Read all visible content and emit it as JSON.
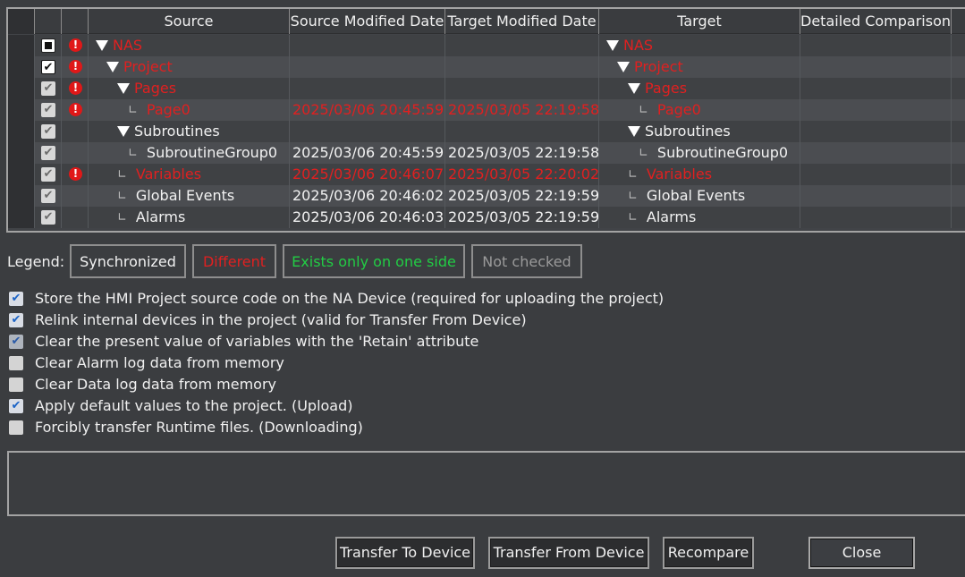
{
  "columns": {
    "source": "Source",
    "source_modified": "Source Modified Date",
    "target_modified": "Target Modified Date",
    "target": "Target",
    "detailed": "Detailed Comparison"
  },
  "rows": [
    {
      "check": "partial",
      "warn": true,
      "level": 0,
      "expander": true,
      "source": "NAS",
      "src_date": "",
      "tgt_date": "",
      "target": "NAS",
      "status": "different"
    },
    {
      "check": "checked",
      "warn": true,
      "level": 1,
      "expander": true,
      "source": "Project",
      "src_date": "",
      "tgt_date": "",
      "target": "Project",
      "status": "different"
    },
    {
      "check": "checked",
      "warn": true,
      "level": 2,
      "expander": true,
      "source": "Pages",
      "src_date": "",
      "tgt_date": "",
      "target": "Pages",
      "status": "different"
    },
    {
      "check": "checked",
      "warn": true,
      "level": 3,
      "expander": false,
      "source": "Page0",
      "src_date": "2025/03/06 20:45:59",
      "tgt_date": "2025/03/05 22:19:58",
      "target": "Page0",
      "status": "different"
    },
    {
      "check": "checked",
      "warn": false,
      "level": 2,
      "expander": true,
      "source": "Subroutines",
      "src_date": "",
      "tgt_date": "",
      "target": "Subroutines",
      "status": "synchronized"
    },
    {
      "check": "checked",
      "warn": false,
      "level": 3,
      "expander": false,
      "source": "SubroutineGroup0",
      "src_date": "2025/03/06 20:45:59",
      "tgt_date": "2025/03/05 22:19:58",
      "target": "SubroutineGroup0",
      "status": "synchronized"
    },
    {
      "check": "checked",
      "warn": true,
      "level": 2,
      "expander": false,
      "source": "Variables",
      "src_date": "2025/03/06 20:46:07",
      "tgt_date": "2025/03/05 22:20:02",
      "target": "Variables",
      "status": "different"
    },
    {
      "check": "checked",
      "warn": false,
      "level": 2,
      "expander": false,
      "source": "Global Events",
      "src_date": "2025/03/06 20:46:02",
      "tgt_date": "2025/03/05 22:19:59",
      "target": "Global Events",
      "status": "synchronized"
    },
    {
      "check": "checked",
      "warn": false,
      "level": 2,
      "expander": false,
      "source": "Alarms",
      "src_date": "2025/03/06 20:46:03",
      "tgt_date": "2025/03/05 22:19:59",
      "target": "Alarms",
      "status": "synchronized"
    }
  ],
  "legend": {
    "label": "Legend:",
    "synchronized": "Synchronized",
    "different": "Different",
    "one_side": "Exists only on one side",
    "not_checked": "Not checked"
  },
  "options": [
    {
      "label": "Store the HMI Project source code on the NA Device (required for uploading the project)",
      "checked": true
    },
    {
      "label": "Relink internal devices in the project (valid for Transfer From Device)",
      "checked": true
    },
    {
      "label": "Clear the present value of variables with the 'Retain' attribute",
      "checked": true,
      "disabled": true
    },
    {
      "label": "Clear Alarm log data from memory",
      "checked": false
    },
    {
      "label": "Clear Data log data from memory",
      "checked": false
    },
    {
      "label": "Apply default values to the project. (Upload)",
      "checked": true
    },
    {
      "label": "Forcibly transfer Runtime files. (Downloading)",
      "checked": false
    }
  ],
  "message": "",
  "buttons": {
    "transfer_to": "Transfer To Device",
    "transfer_from": "Transfer From Device",
    "recompare": "Recompare",
    "close": "Close"
  },
  "colors": {
    "different": "#e02020",
    "synchronized": "#f2f2f2",
    "one_side": "#22cc44",
    "not_checked": "#9a9a9a"
  },
  "icons": {
    "warn": "!",
    "check": "✔",
    "leaf": "∟"
  }
}
